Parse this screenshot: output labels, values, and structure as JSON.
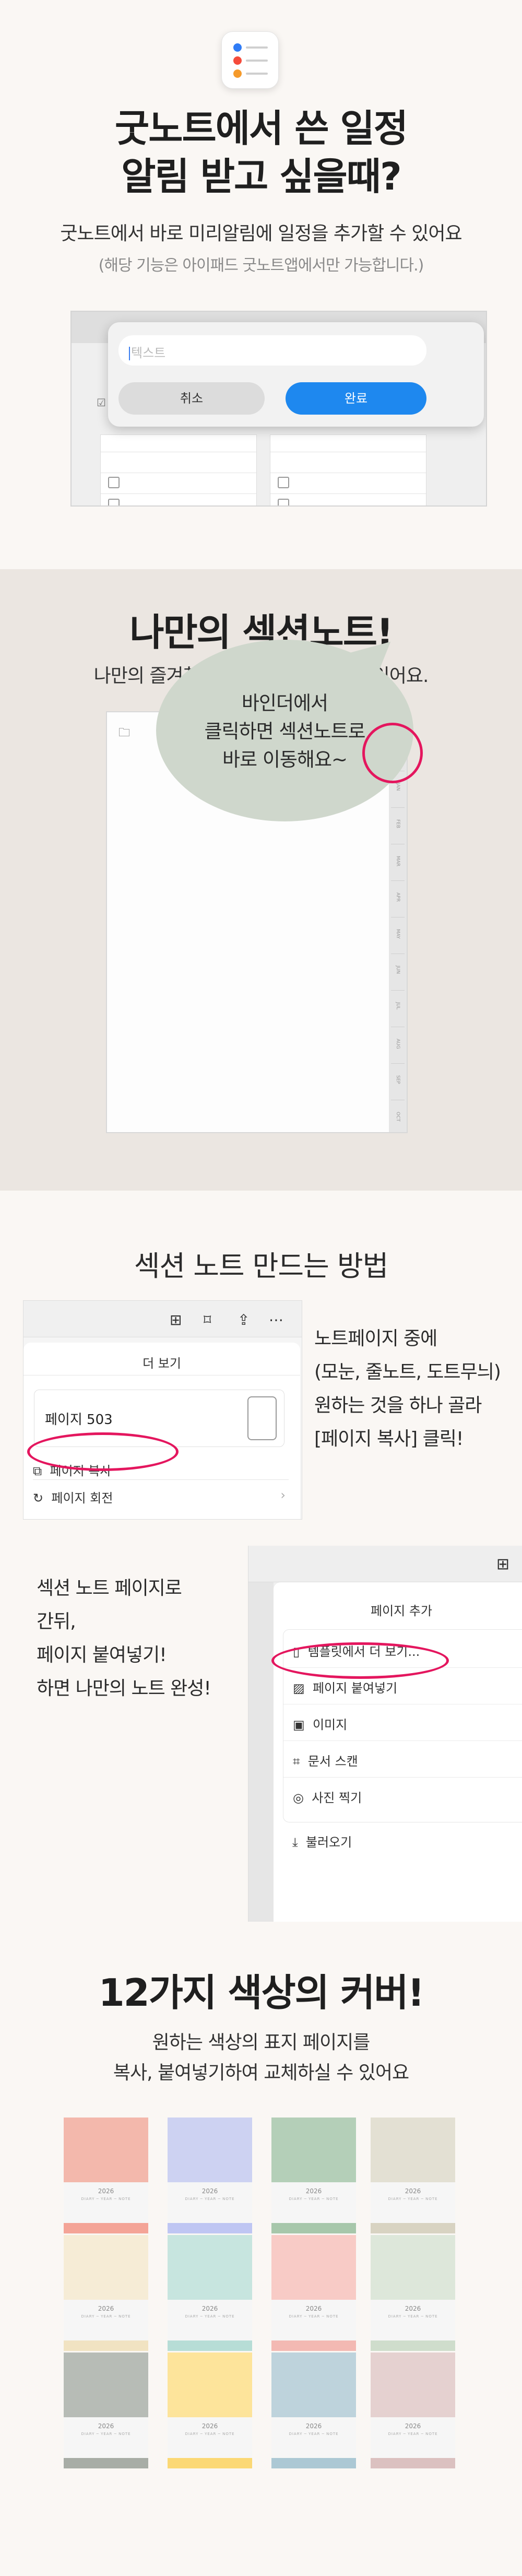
{
  "s1": {
    "title_line1": "굿노트에서 쓴 일정",
    "title_line2": "알림 받고 싶을때?",
    "subtitle": "굿노트에서 바로 미리알림에 일정을 추가할 수 있어요",
    "note": "(해당 기능은 아이패드 굿노트앱에서만 가능합니다.)",
    "text_placeholder": "텍스트",
    "cancel_label": "취소",
    "confirm_label": "완료"
  },
  "s2": {
    "title": "나만의 섹션노트!",
    "subtitle": "나만의 즐겨찾는 노트섹션을 만들 수 있어요.",
    "bubble_line1": "바인더에서",
    "bubble_line2": "클릭하면 섹션노트로",
    "bubble_line3": "바로 이동해요~"
  },
  "s3": {
    "title": "섹션 노트 만드는 방법",
    "more_title": "더 보기",
    "page_label": "페이지 503",
    "copy_page": "페이지 복사",
    "rotate_page": "페이지 회전",
    "desc1_line1": "노트페이지 중에",
    "desc1_line2": "(모눈, 줄노트, 도트무늬)",
    "desc1_line3": "원하는 것을 하나 골라",
    "desc1_line4": "[페이지 복사] 클릭!",
    "desc2_line1": "섹션 노트 페이지로",
    "desc2_line2": "간뒤,",
    "desc2_line3": "페이지 붙여넣기!",
    "desc2_line4": "하면 나만의 노트 완성!",
    "add_page_title": "페이지 추가",
    "add_items": [
      "템플릿에서 더 보기...",
      "페이지 붙여넣기",
      "이미지",
      "문서 스캔",
      "사진 찍기",
      "불러오기"
    ]
  },
  "s4": {
    "title": "12가지 색상의 커버!",
    "subtitle_line1": "원하는 색상의 표지 페이지를",
    "subtitle_line2": "복사, 붙여넣기하여 교체하실 수 있어요",
    "cover_year": "2026",
    "cover_tag": "DIARY ─ YEAR ─ NOTE",
    "cover_colors": [
      "#f3b8ac",
      "#cdd2f2",
      "#b4cfb8",
      "#e3e0d3",
      "#f6ecd6",
      "#c7e5df",
      "#f8cbc6",
      "#dde7da",
      "#b7bcb6",
      "#fde49b",
      "#bed3dc",
      "#e5d1d0"
    ],
    "cover_bottoms": [
      "#f4a497",
      "#bfc6f3",
      "#a7c7ab",
      "#d8d3c2",
      "#f1e3c2",
      "#b7ddd6",
      "#f3b9b3",
      "#cfddcc",
      "#a8ada6",
      "#fbd875",
      "#acc8d4",
      "#dbc1c0"
    ]
  }
}
